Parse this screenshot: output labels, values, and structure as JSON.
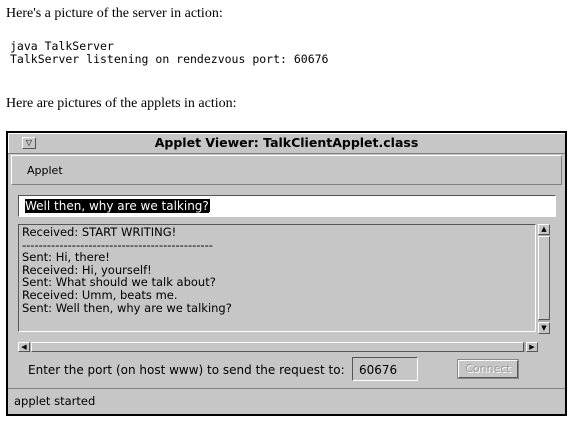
{
  "page": {
    "intro_server": "Here's a picture of the server in action:",
    "console_line1": "java TalkServer",
    "console_line2": "TalkServer listening on rendezvous port: 60676",
    "intro_applets": "Here are pictures of the applets in action:"
  },
  "window": {
    "title": "Applet Viewer: TalkClientApplet.class",
    "menu_button_icon": "▽",
    "menu": {
      "applet_label": "Applet"
    },
    "message_input_value": "Well then, why are we talking?",
    "transcript": [
      "Received: START WRITING!",
      "----------------------------------------------",
      "Sent: Hi, there!",
      "Received: Hi, yourself!",
      "Sent: What should we talk about?",
      "Received: Umm, beats me.",
      "Sent: Well then, why are we talking?"
    ],
    "port_label": "Enter the port (on host www) to send the request to:",
    "port_value": "60676",
    "connect_label": "Connect",
    "status": "applet started"
  },
  "colors": {
    "chrome": "#c6c6c6",
    "scroll_trough": "#a9a9a9",
    "disabled_text": "#9a9a9a"
  },
  "icons": {
    "window_menu": "triangle-down-icon",
    "scroll_up": "triangle-up-icon",
    "scroll_down": "triangle-down-icon",
    "scroll_left": "triangle-left-icon",
    "scroll_right": "triangle-right-icon"
  }
}
